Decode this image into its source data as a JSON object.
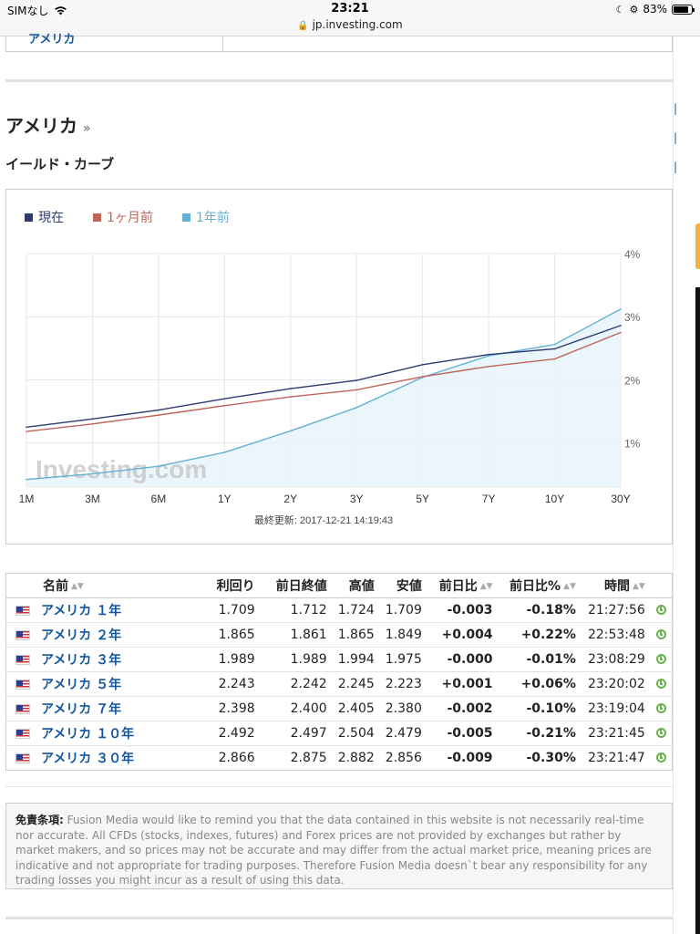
{
  "status_bar": {
    "carrier": "SIMなし",
    "time": "23:21",
    "url": "jp.investing.com",
    "battery": "83%"
  },
  "top_remnant_link": "アメリカ",
  "section": {
    "title": "アメリカ",
    "title_chevron": "»",
    "subtitle": "イールド・カーブ"
  },
  "legend": [
    {
      "label": "現在",
      "color": "#2e3a72"
    },
    {
      "label": "1ヶ月前",
      "color": "#c0645a"
    },
    {
      "label": "1年前",
      "color": "#62b0d4"
    }
  ],
  "chart_data": {
    "type": "line",
    "categories": [
      "1M",
      "3M",
      "6M",
      "1Y",
      "2Y",
      "3Y",
      "5Y",
      "7Y",
      "10Y",
      "30Y"
    ],
    "series": [
      {
        "name": "現在",
        "color": "#2e3a72",
        "values": [
          1.25,
          1.38,
          1.52,
          1.7,
          1.86,
          1.99,
          2.24,
          2.4,
          2.49,
          2.86
        ]
      },
      {
        "name": "1ヶ月前",
        "color": "#c0645a",
        "values": [
          1.18,
          1.3,
          1.44,
          1.59,
          1.73,
          1.84,
          2.05,
          2.21,
          2.33,
          2.75
        ]
      },
      {
        "name": "1年前",
        "color": "#62b0d4",
        "values": [
          0.42,
          0.51,
          0.63,
          0.85,
          1.19,
          1.56,
          2.04,
          2.38,
          2.56,
          3.12
        ]
      }
    ],
    "y_ticks": [
      "1%",
      "2%",
      "3%",
      "4%"
    ],
    "ylim": [
      0.3,
      4.0
    ],
    "grid": true,
    "watermark": "Investing.com",
    "footer": "最終更新: 2017-12-21 14:19:43"
  },
  "table": {
    "headers": [
      "名前",
      "利回り",
      "前日終値",
      "高値",
      "安値",
      "前日比",
      "前日比%",
      "時間"
    ],
    "rows": [
      {
        "name": "アメリカ １年",
        "yield": "1.709",
        "prev": "1.712",
        "high": "1.724",
        "low": "1.709",
        "chg": "-0.003",
        "chg_pct": "-0.18%",
        "time": "21:27:56"
      },
      {
        "name": "アメリカ ２年",
        "yield": "1.865",
        "prev": "1.861",
        "high": "1.865",
        "low": "1.849",
        "chg": "+0.004",
        "chg_pct": "+0.22%",
        "time": "22:53:48"
      },
      {
        "name": "アメリカ ３年",
        "yield": "1.989",
        "prev": "1.989",
        "high": "1.994",
        "low": "1.975",
        "chg": "-0.000",
        "chg_pct": "-0.01%",
        "time": "23:08:29"
      },
      {
        "name": "アメリカ ５年",
        "yield": "2.243",
        "prev": "2.242",
        "high": "2.245",
        "low": "2.223",
        "chg": "+0.001",
        "chg_pct": "+0.06%",
        "time": "23:20:02"
      },
      {
        "name": "アメリカ ７年",
        "yield": "2.398",
        "prev": "2.400",
        "high": "2.405",
        "low": "2.380",
        "chg": "-0.002",
        "chg_pct": "-0.10%",
        "time": "23:19:04"
      },
      {
        "name": "アメリカ １０年",
        "yield": "2.492",
        "prev": "2.497",
        "high": "2.504",
        "low": "2.479",
        "chg": "-0.005",
        "chg_pct": "-0.21%",
        "time": "23:21:45"
      },
      {
        "name": "アメリカ ３０年",
        "yield": "2.866",
        "prev": "2.875",
        "high": "2.882",
        "low": "2.856",
        "chg": "-0.009",
        "chg_pct": "-0.30%",
        "time": "23:21:47"
      }
    ]
  },
  "disclaimer": {
    "label": "免責条項:",
    "text": "Fusion Media would like to remind you that the data contained in this website is not necessarily real-time nor accurate. All CFDs (stocks, indexes, futures) and Forex prices are not provided by exchanges but rather by market makers, and so prices may not be accurate and may differ from the actual market price, meaning prices are indicative and not appropriate for trading purposes. Therefore Fusion Media doesn`t bear any responsibility for any trading losses you might incur as a result of using this data."
  },
  "colors": {
    "link": "#1256a0",
    "positive": "#e0001c",
    "negative": "#15a117",
    "fill": "#e8f5fc"
  }
}
